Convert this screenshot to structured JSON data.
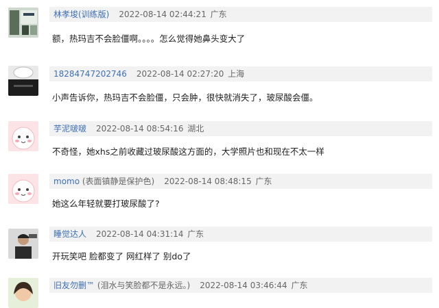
{
  "comments": [
    {
      "username": "林孝埈(训练版)",
      "username_note": "",
      "time": "2022-08-14 02:44:21",
      "location": "广东",
      "content": "额，热玛吉不会脸僵啊。。。。怎么觉得她鼻头变大了",
      "avatar_icon": "photo-avatar-icon"
    },
    {
      "username": "18284747202746",
      "username_note": "",
      "time": "2022-08-14 02:27:20",
      "location": "上海",
      "content": "小声告诉你，热玛吉不会脸僵，只会肿，很快就消失了，玻尿酸会僵。",
      "avatar_icon": "dark-avatar-icon"
    },
    {
      "username": "芋泥啵啵",
      "username_note": "",
      "time": "2022-08-14 08:54:16",
      "location": "湖北",
      "content": "不奇怪，她xhs之前收藏过玻尿酸这方面的，大学照片也和现在不太一样",
      "avatar_icon": "pink-cartoon-avatar-icon"
    },
    {
      "username": "momo",
      "username_note": " (表面镇静是保护色)",
      "time": "2022-08-14 08:48:15",
      "location": "广东",
      "content": "她这么年轻就要打玻尿酸了?",
      "avatar_icon": "pink-cartoon-avatar-icon"
    },
    {
      "username": "睡觉达人",
      "username_note": "",
      "time": "2022-08-14 04:31:14",
      "location": "广东",
      "content": "开玩笑吧 脸都变了 网红样了 别do了",
      "avatar_icon": "person-avatar-icon"
    },
    {
      "username": "旧友勿删™",
      "username_note": " (泪水与笑脸都不是永远。)",
      "time": "2022-08-14 03:46:44",
      "location": "广东",
      "content": "",
      "avatar_icon": "girl-avatar-icon"
    }
  ]
}
